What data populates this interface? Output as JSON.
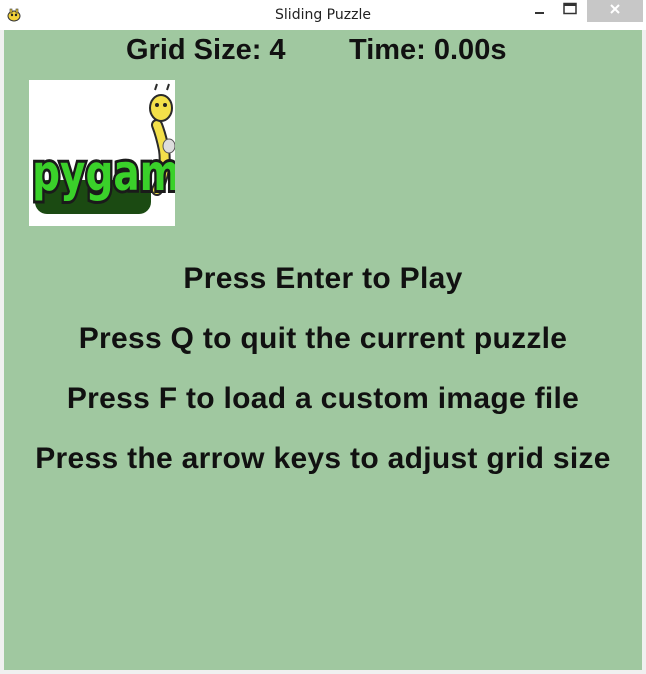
{
  "window": {
    "title": "Sliding Puzzle",
    "app_icon": "pygame-snake-icon",
    "controls": {
      "minimize_icon": "minimize-icon",
      "maximize_icon": "maximize-icon",
      "close_icon": "close-icon"
    }
  },
  "game": {
    "grid_size_text": "Grid Size: 4",
    "time_text": "Time: 0.00s",
    "preview_image": {
      "logo_text": "pygame",
      "icon": "pygame-logo-image"
    },
    "instructions": [
      "Press Enter to Play",
      "Press Q to quit the current puzzle",
      "Press F to load a custom image file",
      "Press the arrow keys to adjust grid size"
    ]
  },
  "colors": {
    "background": "#a0c8a0",
    "text": "#111111",
    "logo_green": "#3ad12a",
    "logo_yellow": "#f3e04a"
  }
}
